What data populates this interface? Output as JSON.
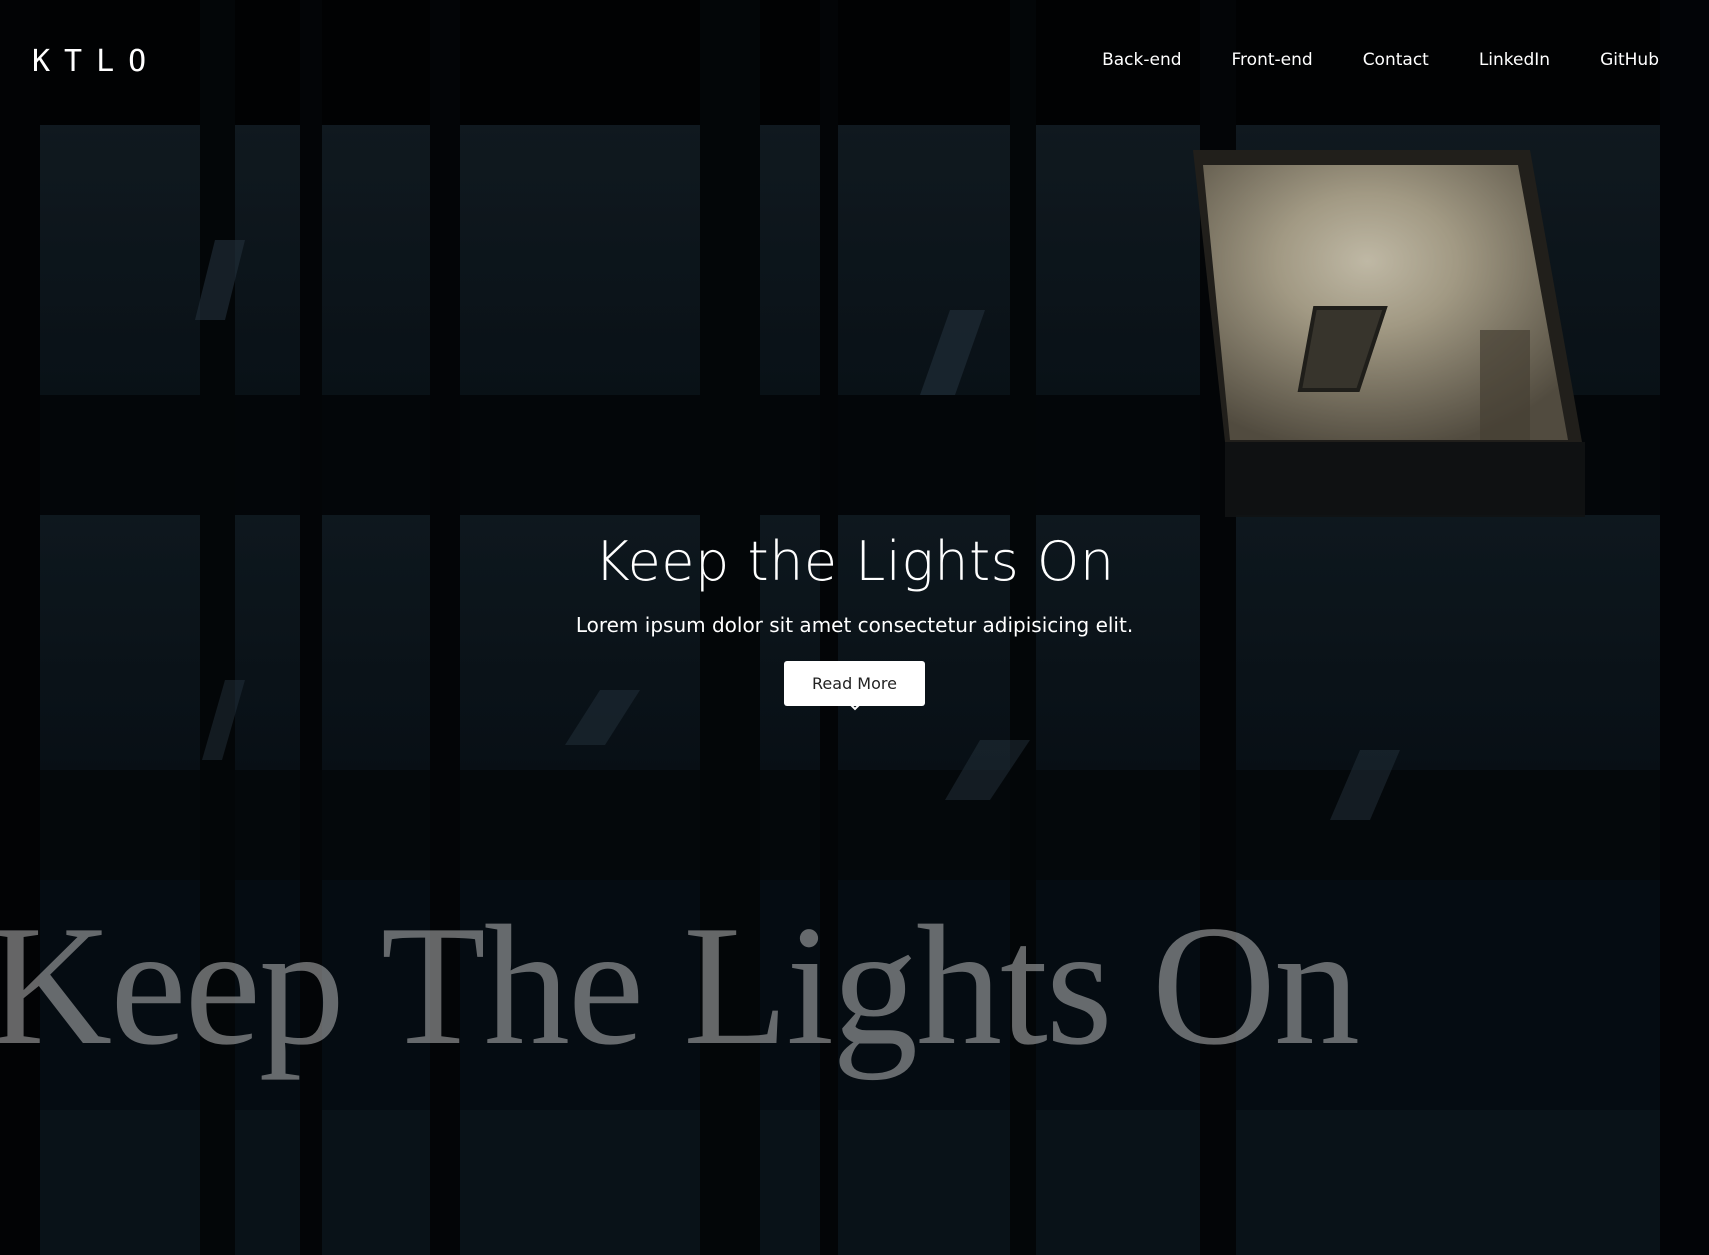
{
  "brand": {
    "logo_text": "KTLO"
  },
  "nav": {
    "items": [
      {
        "label": "Back-end"
      },
      {
        "label": "Front-end"
      },
      {
        "label": "Contact"
      },
      {
        "label": "LinkedIn"
      },
      {
        "label": "GitHub"
      }
    ]
  },
  "hero": {
    "title": "Keep the Lights On",
    "subtitle": "Lorem ipsum dolor sit amet consectetur adipisicing elit.",
    "cta_label": "Read More",
    "scroll_icon": "chevron-down-icon",
    "background_text": "Keep The Lights On"
  },
  "colors": {
    "text": "#ffffff",
    "button_bg": "#ffffff",
    "button_text": "#222222",
    "background": "#05090d"
  }
}
